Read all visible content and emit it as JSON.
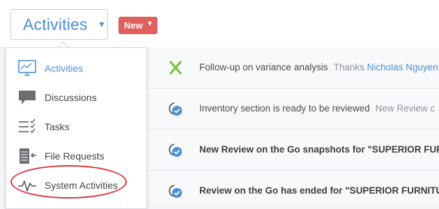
{
  "header": {
    "view_selector": "Activities",
    "new_button": "New"
  },
  "menu": {
    "items": [
      {
        "label": "Activities",
        "icon": "activities-monitor-icon",
        "active": true
      },
      {
        "label": "Discussions",
        "icon": "speech-bubble-icon",
        "active": false
      },
      {
        "label": "Tasks",
        "icon": "checklist-icon",
        "active": false
      },
      {
        "label": "File Requests",
        "icon": "file-request-icon",
        "active": false
      },
      {
        "label": "System Activities",
        "icon": "pulse-icon",
        "active": false
      }
    ]
  },
  "feed": {
    "rows": [
      {
        "icon": "x-mark-icon",
        "title": "Follow-up on variance analysis",
        "meta_prefix": "Thanks",
        "meta_link": "Nicholas Nguyen"
      },
      {
        "icon": "review-check-icon",
        "title": "Inventory section is ready to be reviewed",
        "meta": "New Review c"
      },
      {
        "icon": "review-check-icon",
        "title": "New Review on the Go snapshots for \"SUPERIOR FURN"
      },
      {
        "icon": "review-check-icon",
        "title": "Review on the Go has ended for \"SUPERIOR FURNITUR"
      }
    ]
  },
  "colors": {
    "accent_blue": "#4a90d9",
    "new_button_red": "#e0605e",
    "highlight_ring": "#e0303a",
    "x_mark_green": "#7cc243"
  }
}
